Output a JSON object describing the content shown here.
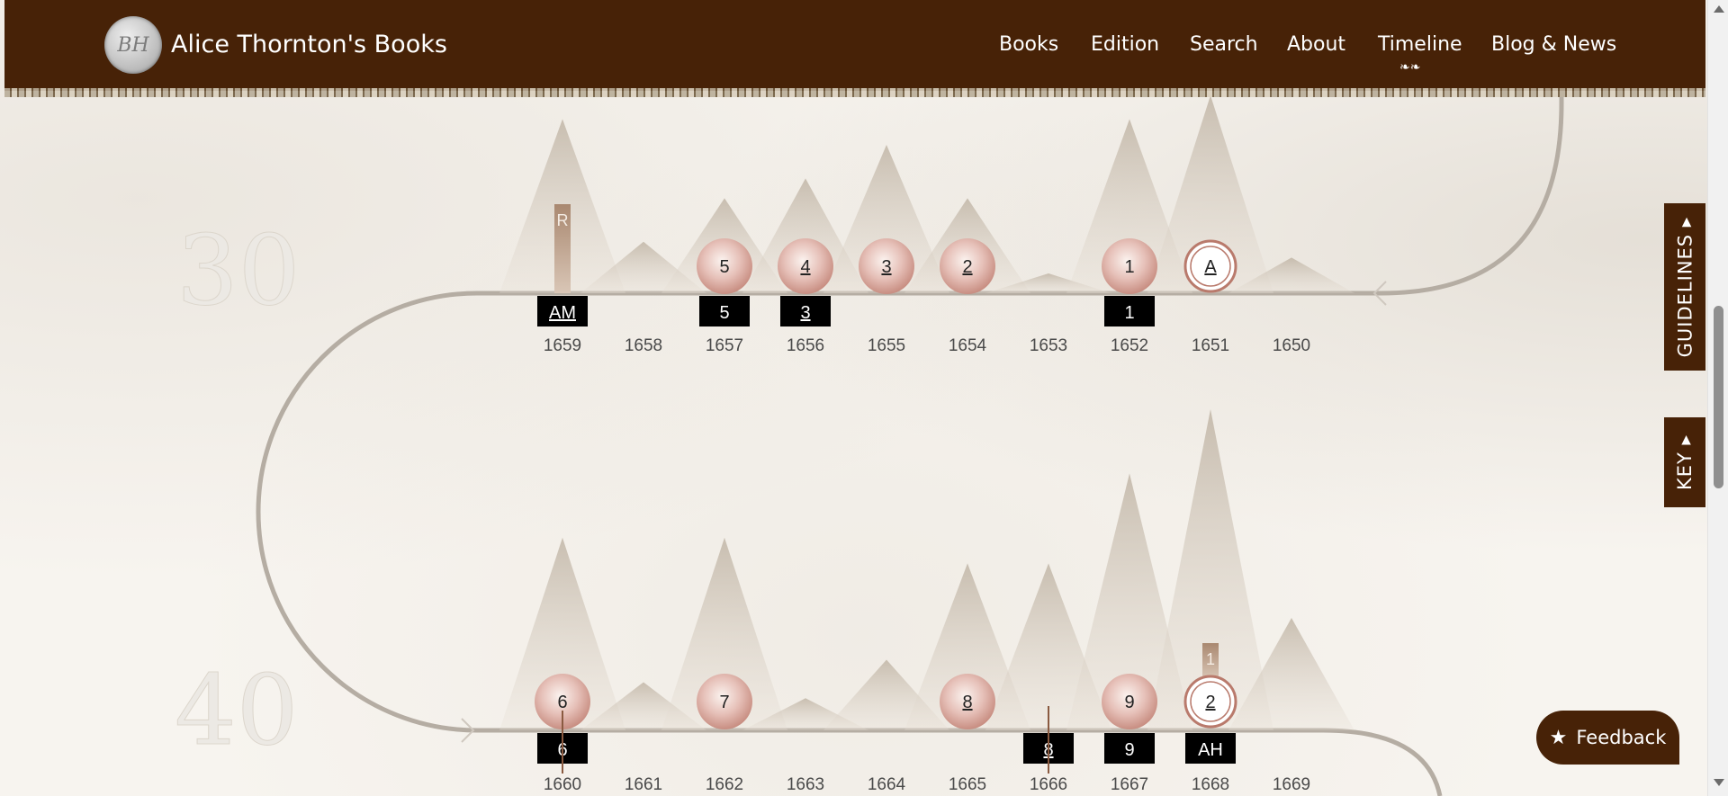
{
  "header": {
    "logo_text": "BH",
    "site_title": "Alice Thornton's Books",
    "nav": [
      {
        "label": "Books",
        "active": false
      },
      {
        "label": "Edition",
        "active": false
      },
      {
        "label": "Search",
        "active": false
      },
      {
        "label": "About",
        "active": false
      },
      {
        "label": "Timeline",
        "active": true
      },
      {
        "label": "Blog & News",
        "active": false
      }
    ],
    "active_ornament_icon": "flourish-icon"
  },
  "timeline": {
    "age_markers": [
      "30",
      "40"
    ],
    "rows": [
      {
        "years": [
          "1659",
          "1658",
          "1657",
          "1656",
          "1655",
          "1654",
          "1653",
          "1652",
          "1651",
          "1650"
        ],
        "peaks_relative": [
          0.88,
          0.26,
          0.48,
          0.58,
          0.75,
          0.48,
          0.1,
          0.88,
          1.0,
          0.18
        ],
        "circles": [
          {
            "year_index": 2,
            "label": "5",
            "underline": false,
            "style": "filled"
          },
          {
            "year_index": 3,
            "label": "4",
            "underline": true,
            "style": "filled"
          },
          {
            "year_index": 4,
            "label": "3",
            "underline": true,
            "style": "filled"
          },
          {
            "year_index": 5,
            "label": "2",
            "underline": true,
            "style": "filled"
          },
          {
            "year_index": 7,
            "label": "1",
            "underline": false,
            "style": "filled"
          },
          {
            "year_index": 8,
            "label": "A",
            "underline": true,
            "style": "ring"
          }
        ],
        "boxes": [
          {
            "year_index": 0,
            "label": "AM",
            "underline": true
          },
          {
            "year_index": 2,
            "label": "5",
            "underline": false
          },
          {
            "year_index": 3,
            "label": "3",
            "underline": true
          },
          {
            "year_index": 7,
            "label": "1",
            "underline": false
          }
        ],
        "flags": [
          {
            "year_index": 0,
            "label": "R"
          }
        ]
      },
      {
        "years": [
          "1660",
          "1661",
          "1662",
          "1663",
          "1664",
          "1665",
          "1666",
          "1667",
          "1668",
          "1669"
        ],
        "peaks_relative": [
          0.6,
          0.15,
          0.6,
          0.1,
          0.22,
          0.52,
          0.52,
          0.8,
          1.0,
          0.35
        ],
        "circles": [
          {
            "year_index": 0,
            "label": "6",
            "underline": false,
            "style": "filled"
          },
          {
            "year_index": 2,
            "label": "7",
            "underline": false,
            "style": "filled"
          },
          {
            "year_index": 5,
            "label": "8",
            "underline": true,
            "style": "filled"
          },
          {
            "year_index": 7,
            "label": "9",
            "underline": false,
            "style": "filled"
          },
          {
            "year_index": 8,
            "label": "2",
            "underline": true,
            "style": "ring"
          }
        ],
        "boxes": [
          {
            "year_index": 0,
            "label": "6",
            "underline": false
          },
          {
            "year_index": 6,
            "label": "8",
            "underline": true
          },
          {
            "year_index": 7,
            "label": "9",
            "underline": false
          },
          {
            "year_index": 8,
            "label": "AH",
            "underline": false
          }
        ],
        "flags": [
          {
            "year_index": 8,
            "label": "1"
          }
        ]
      }
    ]
  },
  "side_tabs": {
    "guidelines": "GUIDELINES ▸",
    "key": "KEY ▸"
  },
  "feedback": {
    "label": "Feedback",
    "icon": "star-icon"
  },
  "colors": {
    "header": "#472207",
    "track": "#b5ada3",
    "circle": "#dca99f",
    "box": "#000000",
    "flag": "#b5967d"
  }
}
